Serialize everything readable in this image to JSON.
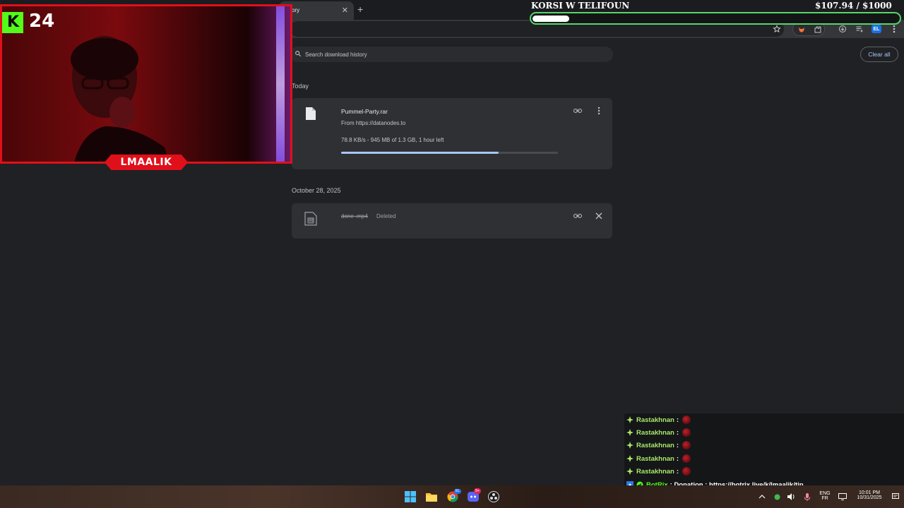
{
  "browser": {
    "tab_title": "History",
    "tab_title_visible": "istory",
    "tab_close": "✕",
    "new_tab": "+",
    "toolbar": {
      "star_icon": "star-icon",
      "extension_icon": "extension-icon",
      "downloads_icon": "download-icon",
      "reading_list_icon": "reading-list-icon",
      "profile_label": "EL",
      "menu_icon": "menu-icon"
    }
  },
  "downloads": {
    "search_placeholder": "Search download history",
    "clear_all_label": "Clear all",
    "sections": [
      {
        "title": "Today",
        "items": [
          {
            "name": "Pummel-Party.rar",
            "source": "From https://datanodes.to",
            "status": "78.8 KB/s - 945 MB of 1.3 GB, 1 hour left",
            "progress": 0.727
          }
        ]
      },
      {
        "title": "October 28, 2025",
        "items": [
          {
            "name": "done .mp4",
            "status": "Deleted"
          }
        ]
      }
    ]
  },
  "stream_overlay": {
    "kick_number": "24",
    "streamer_name": "LMAALIK",
    "goal_title": "KORSI W TELIFOUN",
    "goal_amount": "$107.94   / $1000",
    "goal_progress": 0.10794,
    "accent_color": "#53fc18",
    "cam_border_color": "#e0101a"
  },
  "chat": {
    "messages": [
      {
        "user": "Rastakhnan",
        "sep": ":",
        "emote": "red-emote"
      },
      {
        "user": "Rastakhnan",
        "sep": ":",
        "emote": "red-emote"
      },
      {
        "user": "Rastakhnan",
        "sep": ":",
        "emote": "red-emote"
      },
      {
        "user": "Rastakhnan",
        "sep": ":",
        "emote": "red-emote"
      },
      {
        "user": "Rastakhnan",
        "sep": ":",
        "emote": "red-emote"
      }
    ],
    "bot": {
      "user": "BotRix",
      "message": ": Donation : https://botrix.live/k/lmaalik/tip"
    }
  },
  "taskbar": {
    "apps": [
      "windows-start-icon",
      "file-explorer-icon",
      "chrome-icon",
      "discord-icon",
      "obs-icon"
    ],
    "discord_badge": "9+",
    "chrome_badge": "EL",
    "lang_top": "ENG",
    "lang_bottom": "FR",
    "time": "10:01 PM",
    "date": "10/31/2025"
  }
}
